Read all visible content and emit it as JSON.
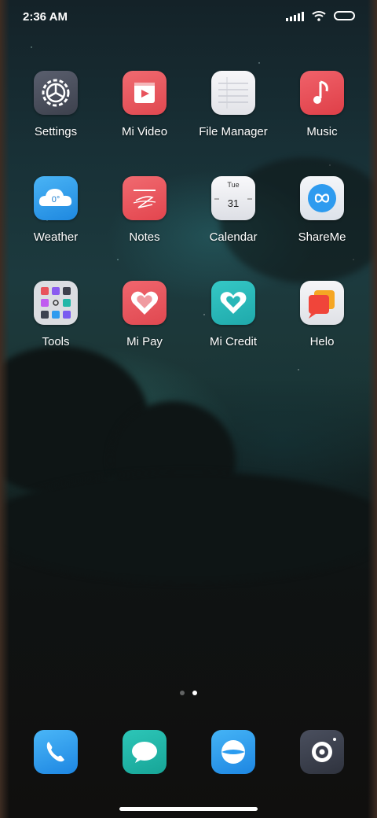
{
  "status_bar": {
    "time": "2:36 AM",
    "icons": [
      "signal-icon",
      "wifi-icon",
      "battery-icon"
    ]
  },
  "apps": [
    {
      "label": "Settings",
      "icon": "settings-gear-icon"
    },
    {
      "label": "Mi Video",
      "icon": "video-play-icon"
    },
    {
      "label": "File Manager",
      "icon": "folder-paper-icon"
    },
    {
      "label": "Music",
      "icon": "music-note-icon"
    },
    {
      "label": "Weather",
      "icon": "weather-cloud-icon",
      "text": "0°"
    },
    {
      "label": "Notes",
      "icon": "notes-pen-icon"
    },
    {
      "label": "Calendar",
      "icon": "calendar-icon",
      "day_name": "Tue",
      "day_number": "31"
    },
    {
      "label": "ShareMe",
      "icon": "shareme-infinity-icon"
    },
    {
      "label": "Tools",
      "icon": "tools-folder-icon"
    },
    {
      "label": "Mi Pay",
      "icon": "heart-pay-icon"
    },
    {
      "label": "Mi Credit",
      "icon": "heart-credit-icon"
    },
    {
      "label": "Helo",
      "icon": "chat-bubble-icon"
    }
  ],
  "page_indicator": {
    "pages": 2,
    "active": 2
  },
  "dock": [
    {
      "icon": "phone-icon"
    },
    {
      "icon": "messages-icon"
    },
    {
      "icon": "browser-icon"
    },
    {
      "icon": "camera-icon"
    }
  ],
  "colors": {
    "settings": "#4a4e5c",
    "mi_video": "#e8535c",
    "music": "#e5474f",
    "weather": "#2f9de8",
    "notes": "#e85157",
    "mi_pay": "#e4535c",
    "mi_credit": "#29b7b8",
    "dock_phone": "#2a9ff0",
    "dock_messages": "#22b7a8",
    "dock_browser": "#2b9cf0",
    "dock_camera": "#3b3f4c"
  }
}
